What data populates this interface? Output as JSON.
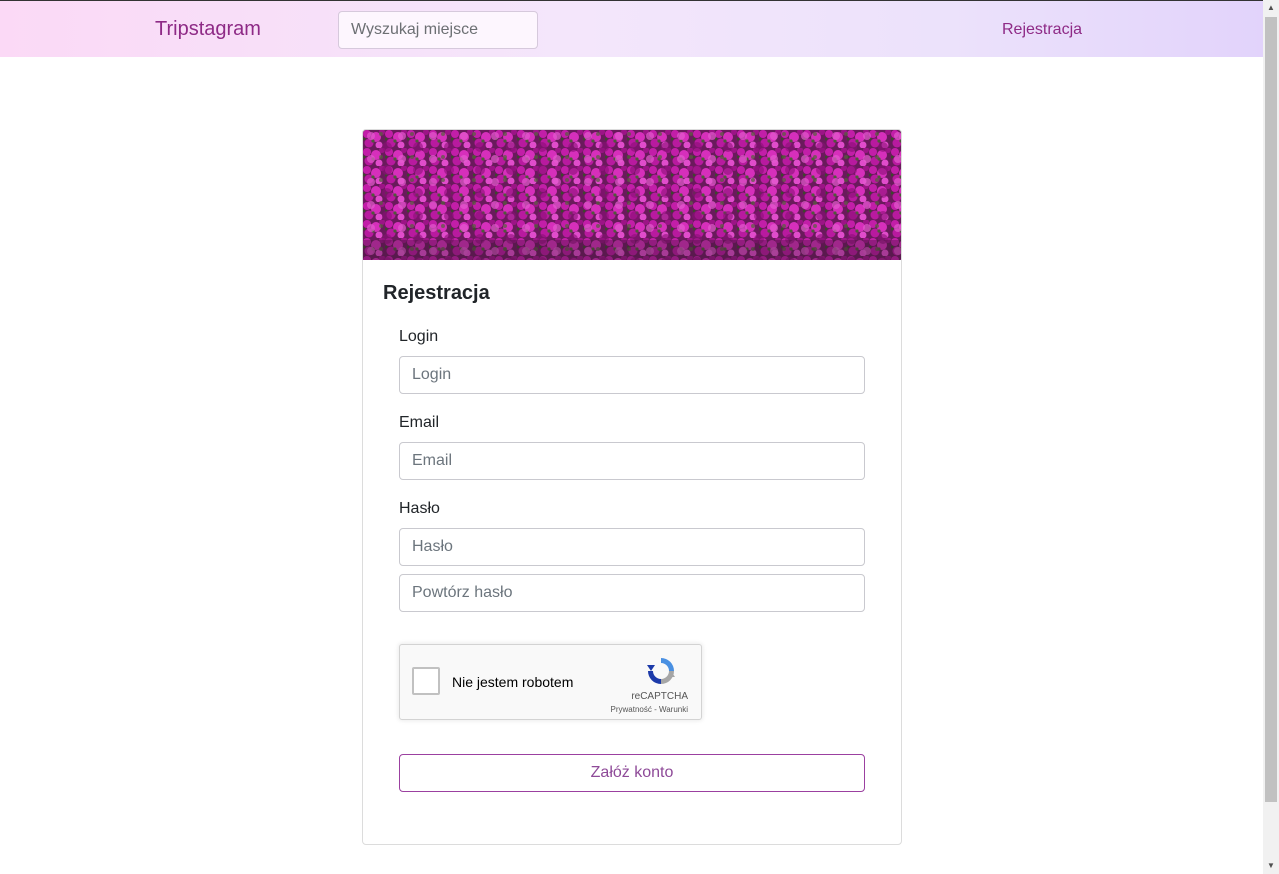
{
  "navbar": {
    "brand": "Tripstagram",
    "search_placeholder": "Wyszukaj miejsce",
    "register_link": "Rejestracja"
  },
  "card": {
    "title": "Rejestracja",
    "login": {
      "label": "Login",
      "placeholder": "Login"
    },
    "email": {
      "label": "Email",
      "placeholder": "Email"
    },
    "password": {
      "label": "Hasło",
      "placeholder": "Hasło",
      "repeat_placeholder": "Powtórz hasło"
    },
    "recaptcha": {
      "checkbox_label": "Nie jestem robotem",
      "brand": "reCAPTCHA",
      "links": "Prywatność - Warunki"
    },
    "submit_label": "Załóż konto"
  },
  "colors": {
    "brand": "#8e2a86",
    "button_border": "#9b40a0",
    "flower": "#b0159a"
  }
}
